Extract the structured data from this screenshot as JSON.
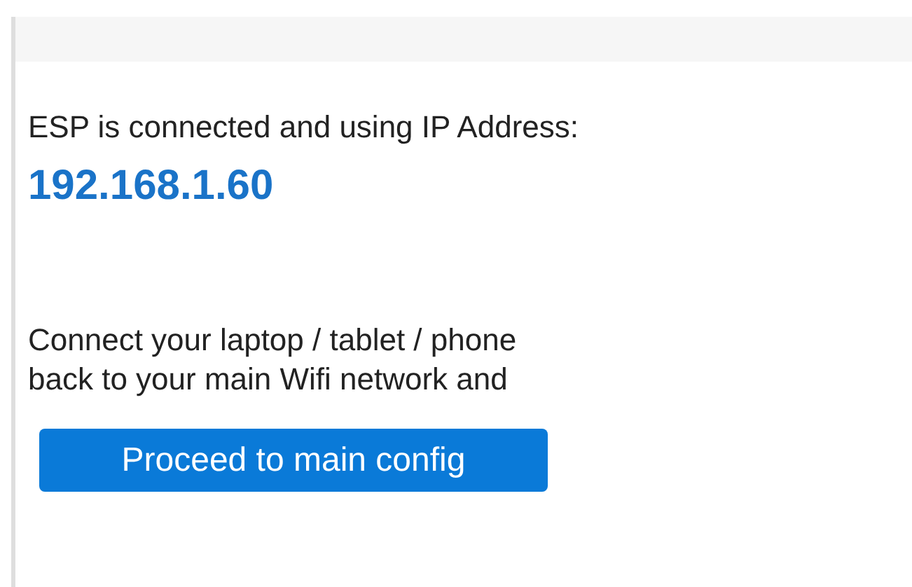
{
  "status_text": "ESP is connected and using IP Address:",
  "ip_address": "192.168.1.60",
  "instruction": "Connect your laptop / tablet / phone\nback to your main Wifi network and",
  "button": {
    "label": "Proceed to main config"
  }
}
